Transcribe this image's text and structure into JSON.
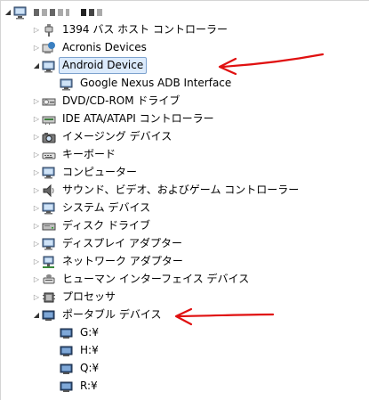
{
  "tree": {
    "root": {
      "label": "",
      "icon": "computer-icon"
    },
    "items": [
      {
        "label": "1394 バス ホスト コントローラー",
        "icon": "firewire-icon",
        "state": "collapsed"
      },
      {
        "label": "Acronis Devices",
        "icon": "acronis-device-icon",
        "state": "collapsed"
      },
      {
        "label": "Android Device",
        "icon": "android-device-icon",
        "state": "expanded",
        "selected": true
      },
      {
        "label": "Google Nexus ADB Interface",
        "icon": "adb-interface-icon",
        "state": "leaf"
      },
      {
        "label": "DVD/CD-ROM ドライブ",
        "icon": "dvd-drive-icon",
        "state": "collapsed"
      },
      {
        "label": "IDE ATA/ATAPI コントローラー",
        "icon": "ide-controller-icon",
        "state": "collapsed"
      },
      {
        "label": "イメージング デバイス",
        "icon": "camera-icon",
        "state": "collapsed"
      },
      {
        "label": "キーボード",
        "icon": "keyboard-icon",
        "state": "collapsed"
      },
      {
        "label": "コンピューター",
        "icon": "computer-monitor-icon",
        "state": "collapsed"
      },
      {
        "label": "サウンド、ビデオ、およびゲーム コントローラー",
        "icon": "speaker-icon",
        "state": "collapsed"
      },
      {
        "label": "システム デバイス",
        "icon": "system-device-icon",
        "state": "collapsed"
      },
      {
        "label": "ディスク ドライブ",
        "icon": "disk-drive-icon",
        "state": "collapsed"
      },
      {
        "label": "ディスプレイ アダプター",
        "icon": "display-adapter-icon",
        "state": "collapsed"
      },
      {
        "label": "ネットワーク アダプター",
        "icon": "network-adapter-icon",
        "state": "collapsed"
      },
      {
        "label": "ヒューマン インターフェイス デバイス",
        "icon": "hid-icon",
        "state": "collapsed"
      },
      {
        "label": "プロセッサ",
        "icon": "processor-icon",
        "state": "collapsed"
      },
      {
        "label": "ポータブル デバイス",
        "icon": "portable-device-icon",
        "state": "expanded"
      },
      {
        "label": "G:¥",
        "icon": "portable-device-icon",
        "state": "leaf"
      },
      {
        "label": "H:¥",
        "icon": "portable-device-icon",
        "state": "leaf"
      },
      {
        "label": "Q:¥",
        "icon": "portable-device-icon",
        "state": "leaf"
      },
      {
        "label": "R:¥",
        "icon": "portable-device-icon",
        "state": "leaf"
      }
    ]
  },
  "colors": {
    "selection_bg": "#dcebfc",
    "selection_border": "#7da2ce",
    "annotation_arrow": "#e01010"
  },
  "toggles": {
    "collapsed": "▷",
    "expanded": "◢"
  }
}
